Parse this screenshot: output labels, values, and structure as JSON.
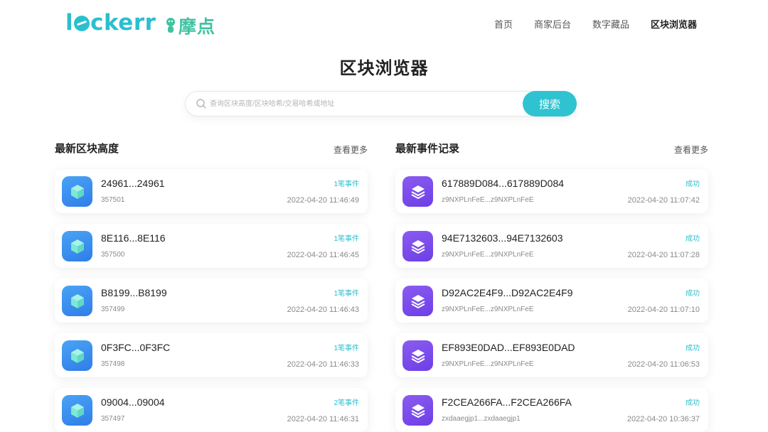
{
  "header": {
    "logo_parts": [
      "l",
      "ckerr"
    ],
    "partner_name": "摩点",
    "nav": [
      "首页",
      "商家后台",
      "数字藏品",
      "区块浏览器"
    ],
    "active_nav": 3
  },
  "page_title": "区块浏览器",
  "search": {
    "placeholder": "查询区块高度/区块哈希/交易哈希或地址",
    "button_label": "搜索"
  },
  "blocks": {
    "title": "最新区块高度",
    "more_label": "查看更多",
    "items": [
      {
        "hash": "24961...24961",
        "height": "357501",
        "events": "1笔事件",
        "time": "2022-04-20 11:46:49"
      },
      {
        "hash": "8E116...8E116",
        "height": "357500",
        "events": "1笔事件",
        "time": "2022-04-20 11:46:45"
      },
      {
        "hash": "B8199...B8199",
        "height": "357499",
        "events": "1笔事件",
        "time": "2022-04-20 11:46:43"
      },
      {
        "hash": "0F3FC...0F3FC",
        "height": "357498",
        "events": "1笔事件",
        "time": "2022-04-20 11:46:33"
      },
      {
        "hash": "09004...09004",
        "height": "357497",
        "events": "2笔事件",
        "time": "2022-04-20 11:46:31"
      }
    ]
  },
  "events": {
    "title": "最新事件记录",
    "more_label": "查看更多",
    "items": [
      {
        "hash": "617889D084...617889D084",
        "address": "z9NXPLnFeE...z9NXPLnFeE",
        "status": "成功",
        "time": "2022-04-20 11:07:42"
      },
      {
        "hash": "94E7132603...94E7132603",
        "address": "z9NXPLnFeE...z9NXPLnFeE",
        "status": "成功",
        "time": "2022-04-20 11:07:28"
      },
      {
        "hash": "D92AC2E4F9...D92AC2E4F9",
        "address": "z9NXPLnFeE...z9NXPLnFeE",
        "status": "成功",
        "time": "2022-04-20 11:07:10"
      },
      {
        "hash": "EF893E0DAD...EF893E0DAD",
        "address": "z9NXPLnFeE...z9NXPLnFeE",
        "status": "成功",
        "time": "2022-04-20 11:06:53"
      },
      {
        "hash": "F2CEA266FA...F2CEA266FA",
        "address": "zxdaaegjp1...zxdaaegjp1",
        "status": "成功",
        "time": "2022-04-20 10:36:37"
      }
    ]
  },
  "colors": {
    "accent": "#2fc3d1",
    "block_icon": "#3a8ff0",
    "event_icon": "#7b4de9",
    "partner": "#3fc3a2"
  },
  "icons": {
    "block": "cube-icon",
    "event": "layers-icon",
    "search": "search-icon"
  }
}
